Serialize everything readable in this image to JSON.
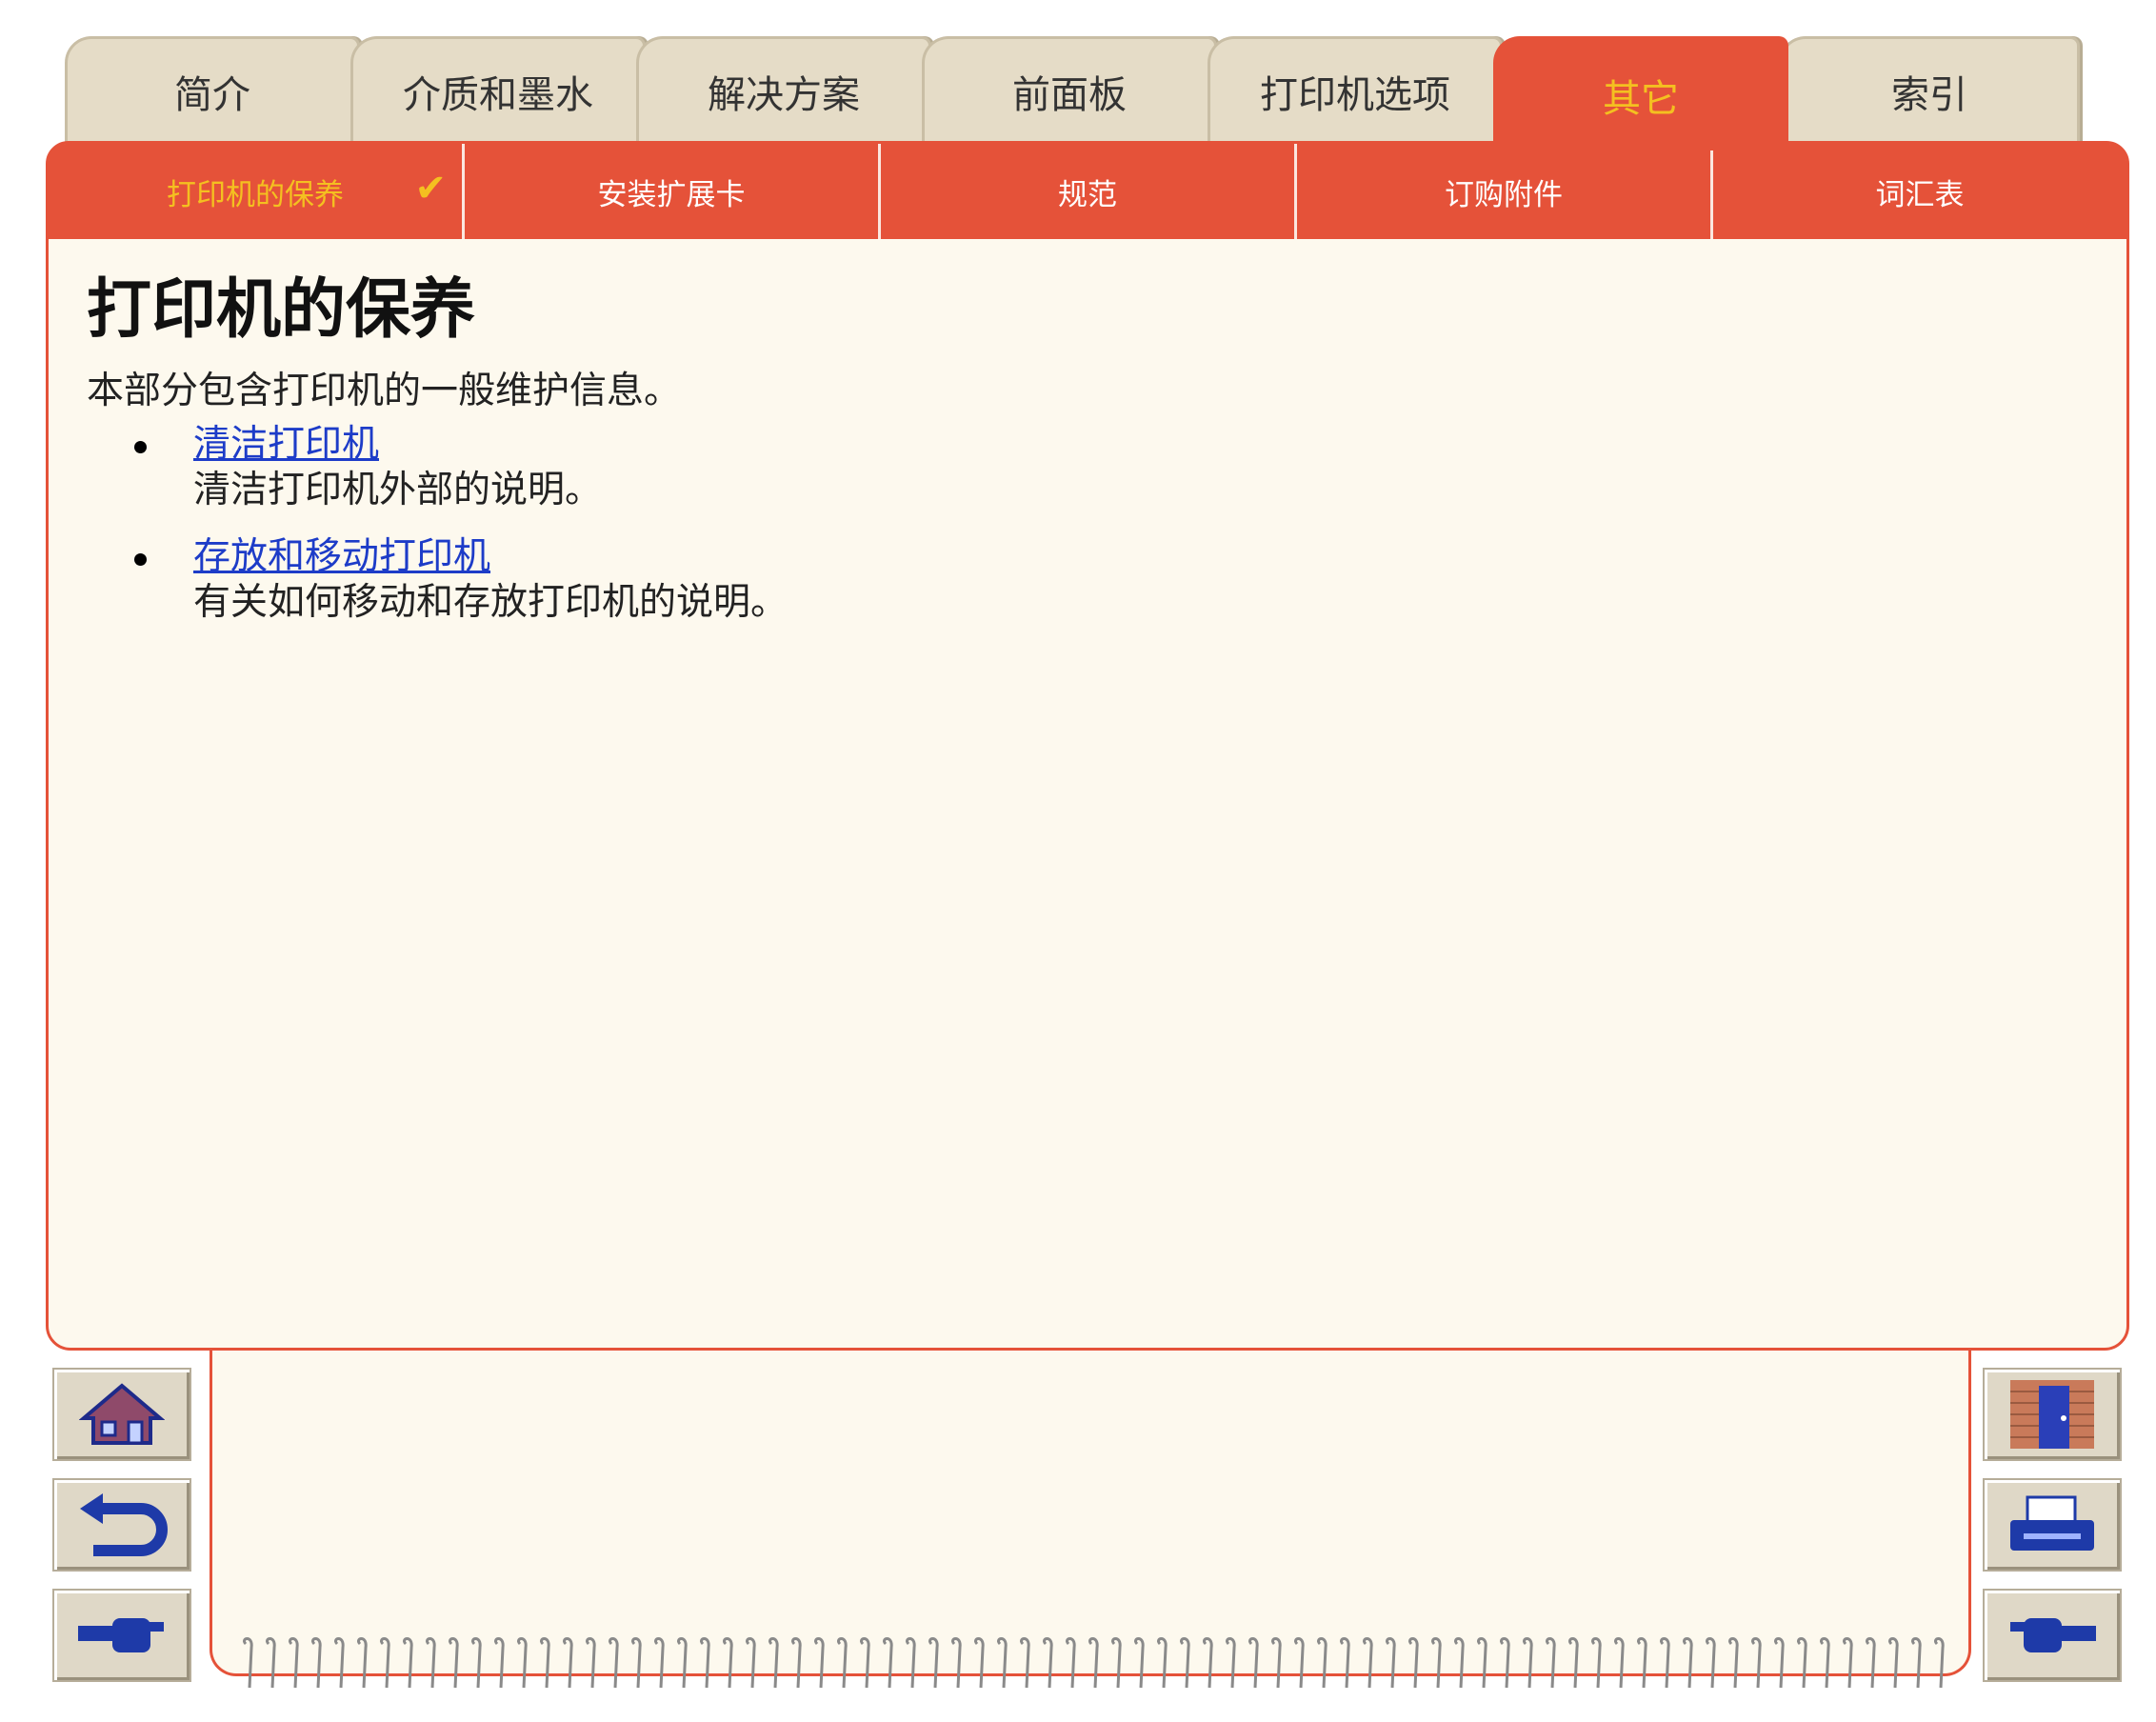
{
  "tabs": [
    {
      "label": "简介"
    },
    {
      "label": "介质和墨水"
    },
    {
      "label": "解决方案"
    },
    {
      "label": "前面板"
    },
    {
      "label": "打印机选项"
    },
    {
      "label": "其它"
    },
    {
      "label": "索引"
    }
  ],
  "subtabs": [
    {
      "label": "打印机的保养"
    },
    {
      "label": "安装扩展卡"
    },
    {
      "label": "规范"
    },
    {
      "label": "订购附件"
    },
    {
      "label": "词汇表"
    }
  ],
  "active_subtab_check": "✔",
  "page": {
    "title": "打印机的保养",
    "intro": "本部分包含打印机的一般维护信息。",
    "items": [
      {
        "link": "清洁打印机",
        "desc": "清洁打印机外部的说明。"
      },
      {
        "link": "存放和移动打印机",
        "desc": "有关如何移动和存放打印机的说明。"
      }
    ]
  },
  "nav_icons": {
    "left": [
      "home-icon",
      "back-icon",
      "forward-hand-icon"
    ],
    "right": [
      "exit-door-icon",
      "printer-icon",
      "next-hand-icon"
    ]
  },
  "colors": {
    "accent": "#e55239",
    "active_text": "#f4c020",
    "tab_bg": "#e5dcc7",
    "panel_bg": "#fdf9ee",
    "link": "#1d3cc8"
  }
}
